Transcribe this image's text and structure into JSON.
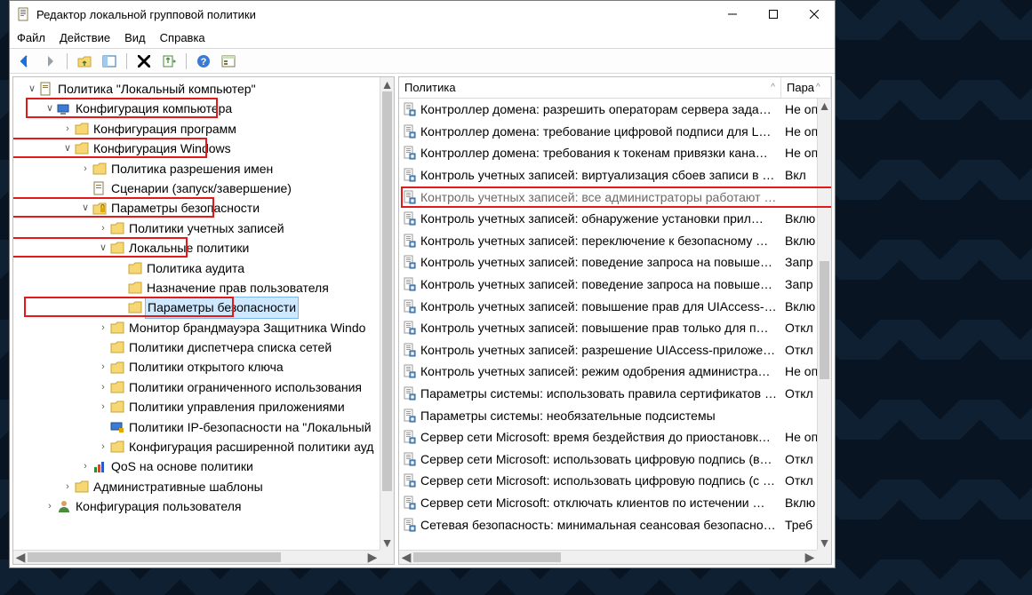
{
  "window": {
    "title": "Редактор локальной групповой политики"
  },
  "menu": {
    "file": "Файл",
    "action": "Действие",
    "view": "Вид",
    "help": "Справка"
  },
  "tree": {
    "root": "Политика \"Локальный компьютер\"",
    "comp_config": "Конфигурация компьютера",
    "software": "Конфигурация программ",
    "windows_config": "Конфигурация Windows",
    "name_res_policy": "Политика разрешения имен",
    "scripts": "Сценарии (запуск/завершение)",
    "security_settings": "Параметры безопасности",
    "account_policies": "Политики учетных записей",
    "local_policies": "Локальные политики",
    "audit_policy": "Политика аудита",
    "user_rights": "Назначение прав пользователя",
    "security_options": "Параметры безопасности",
    "firewall_monitor": "Монитор брандмауэра Защитника Windo",
    "netlist_policies": "Политики диспетчера списка сетей",
    "public_key": "Политики открытого ключа",
    "software_restriction": "Политики ограниченного использования",
    "app_control": "Политики управления приложениями",
    "ipsec_policies": "Политики IP-безопасности на \"Локальный",
    "adv_audit": "Конфигурация расширенной политики ауд",
    "qos": "QoS на основе политики",
    "admin_templates": "Административные шаблоны",
    "user_config": "Конфигурация пользователя"
  },
  "list": {
    "header_policy": "Политика",
    "header_param": "Пара",
    "rows": [
      {
        "name": "Контроллер домена: разрешить операторам сервера задав…",
        "param": "Не оп"
      },
      {
        "name": "Контроллер домена: требование цифровой подписи для L…",
        "param": "Не оп"
      },
      {
        "name": "Контроллер домена: требования к токенам привязки кана…",
        "param": "Не оп"
      },
      {
        "name": "Контроль учетных записей: виртуализация сбоев записи в …",
        "param": "Вкл"
      },
      {
        "name": "Контроль учетных записей: все администраторы работают в режиме одобрения администратором",
        "param": ""
      },
      {
        "name": "Контроль учетных записей: обнаружение установки прил…",
        "param": "Вклю"
      },
      {
        "name": "Контроль учетных записей: переключение к безопасному …",
        "param": "Вклю"
      },
      {
        "name": "Контроль учетных записей: поведение запроса на повыше…",
        "param": "Запр"
      },
      {
        "name": "Контроль учетных записей: поведение запроса на повыше…",
        "param": "Запр"
      },
      {
        "name": "Контроль учетных записей: повышение прав для UIAccess-…",
        "param": "Вклю"
      },
      {
        "name": "Контроль учетных записей: повышение прав только для п…",
        "param": "Откл"
      },
      {
        "name": "Контроль учетных записей: разрешение UIAccess-приложе…",
        "param": "Откл"
      },
      {
        "name": "Контроль учетных записей: режим одобрения администра…",
        "param": "Не оп"
      },
      {
        "name": "Параметры системы: использовать правила сертификатов …",
        "param": "Откл"
      },
      {
        "name": "Параметры системы: необязательные подсистемы",
        "param": ""
      },
      {
        "name": "Сервер сети Microsoft: время бездействия до приостановк…",
        "param": "Не оп"
      },
      {
        "name": "Сервер сети Microsoft: использовать цифровую подпись (в…",
        "param": "Откл"
      },
      {
        "name": "Сервер сети Microsoft: использовать цифровую подпись (с …",
        "param": "Откл"
      },
      {
        "name": "Сервер сети Microsoft: отключать клиентов по истечении …",
        "param": "Вклю"
      },
      {
        "name": "Сетевая безопасность: минимальная сеансовая безопасно…",
        "param": "Треб"
      }
    ]
  }
}
